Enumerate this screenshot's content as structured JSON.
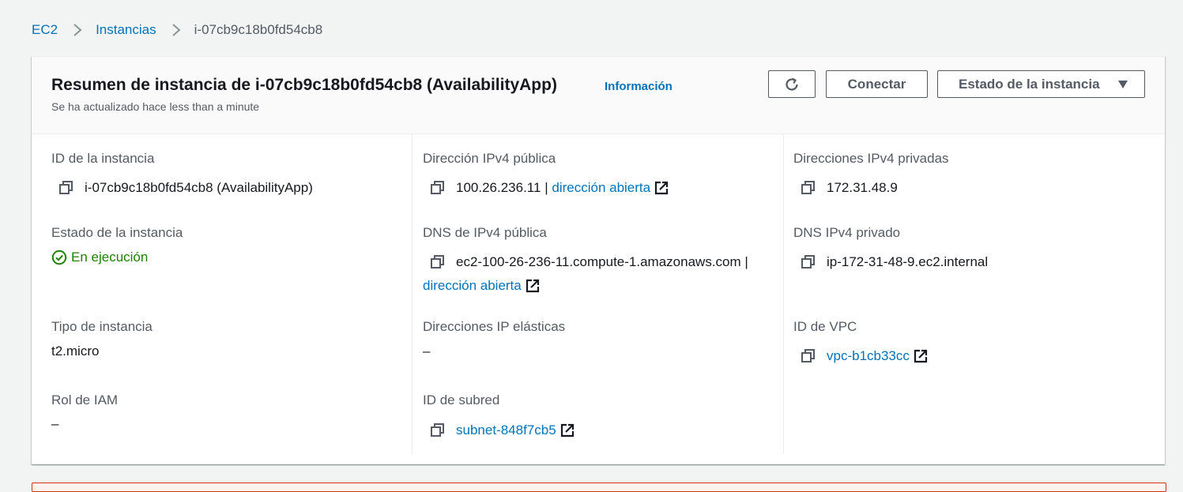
{
  "breadcrumb": {
    "items": [
      {
        "label": "EC2"
      },
      {
        "label": "Instancias"
      }
    ],
    "current": "i-07cb9c18b0fd54cb8"
  },
  "panel": {
    "title": "Resumen de instancia de i-07cb9c18b0fd54cb8 (AvailabilityApp)",
    "info_link": "Información",
    "subtitle": "Se ha actualizado hace less than a minute",
    "buttons": {
      "refresh_icon": "refresh-icon",
      "connect": "Conectar",
      "instance_state": "Estado de la instancia"
    }
  },
  "details": {
    "instance_id": {
      "label": "ID de la instancia",
      "value": "i-07cb9c18b0fd54cb8 (AvailabilityApp)"
    },
    "instance_state": {
      "label": "Estado de la instancia",
      "value": "En ejecución",
      "color": "#1d8102"
    },
    "instance_type": {
      "label": "Tipo de instancia",
      "value": "t2.micro"
    },
    "iam_role": {
      "label": "Rol de IAM",
      "value": "–"
    },
    "public_ipv4": {
      "label": "Dirección IPv4 pública",
      "value": "100.26.236.11",
      "separator": "|",
      "link": "dirección abierta"
    },
    "public_dns": {
      "label": "DNS de IPv4 pública",
      "value": "ec2-100-26-236-11.compute-1.amazonaws.com",
      "separator": "|",
      "link": "dirección abierta"
    },
    "elastic_ips": {
      "label": "Direcciones IP elásticas",
      "value": "–"
    },
    "subnet_id": {
      "label": "ID de subred",
      "value": "subnet-848f7cb5"
    },
    "private_ipv4": {
      "label": "Direcciones IPv4 privadas",
      "value": "172.31.48.9"
    },
    "private_dns": {
      "label": "DNS IPv4 privado",
      "value": "ip-172-31-48-9.ec2.internal"
    },
    "vpc_id": {
      "label": "ID de VPC",
      "value": "vpc-b1cb33cc"
    }
  },
  "colors": {
    "link": "#0073bb",
    "success": "#1d8102",
    "label": "#545b64",
    "alert_border": "#d13212"
  }
}
